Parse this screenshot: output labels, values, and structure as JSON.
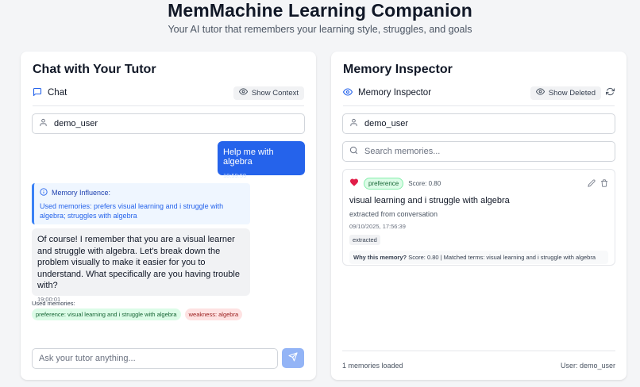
{
  "header": {
    "title": "MemMachine Learning Companion",
    "subtitle": "Your AI tutor that remembers your learning style, struggles, and goals"
  },
  "chat_panel": {
    "title": "Chat with Your Tutor",
    "tab_label": "Chat",
    "show_context_label": "Show Context",
    "user_id": "demo_user",
    "messages": [
      {
        "role": "user",
        "text": "Help me with algebra",
        "time": "18:59:59"
      },
      {
        "role": "assistant",
        "influence_title": "Memory Influence:",
        "influence_body": "Used memories: prefers visual learning and i struggle with algebra; struggles with algebra",
        "text": "Of course! I remember that you are a visual learner and struggle with algebra. Let's break down the problem visually to make it easier for you to understand. What specifically are you having trouble with?",
        "time": "19:00:01"
      }
    ],
    "used_memories_label": "Used memories:",
    "used_memories": [
      {
        "label": "preference: visual learning and i struggle with algebra",
        "kind": "preference"
      },
      {
        "label": "weakness: algebra",
        "kind": "weakness"
      }
    ],
    "input_placeholder": "Ask your tutor anything..."
  },
  "memory_panel": {
    "title": "Memory Inspector",
    "tab_label": "Memory Inspector",
    "show_deleted_label": "Show Deleted",
    "user_id": "demo_user",
    "search_placeholder": "Search memories...",
    "memories": [
      {
        "type": "preference",
        "score": "Score: 0.80",
        "content": "visual learning and i struggle with algebra",
        "source": "extracted from conversation",
        "date": "09/10/2025, 17:56:39",
        "badge": "extracted",
        "why_label": "Why this memory?",
        "why_text": "Score: 0.80 | Matched terms: visual learning and i struggle with algebra"
      }
    ],
    "footer_count": "1 memories loaded",
    "footer_user": "User: demo_user"
  },
  "colors": {
    "accent": "#2563eb",
    "send_button": "#93b4f6",
    "preference_bg": "#dcfce7",
    "weakness_bg": "#fee2e2",
    "heart": "#e11d48"
  },
  "icons": [
    "chat-icon",
    "eye-icon",
    "user-icon",
    "send-icon",
    "info-icon",
    "search-icon",
    "refresh-icon",
    "heart-icon",
    "edit-icon",
    "trash-icon"
  ]
}
